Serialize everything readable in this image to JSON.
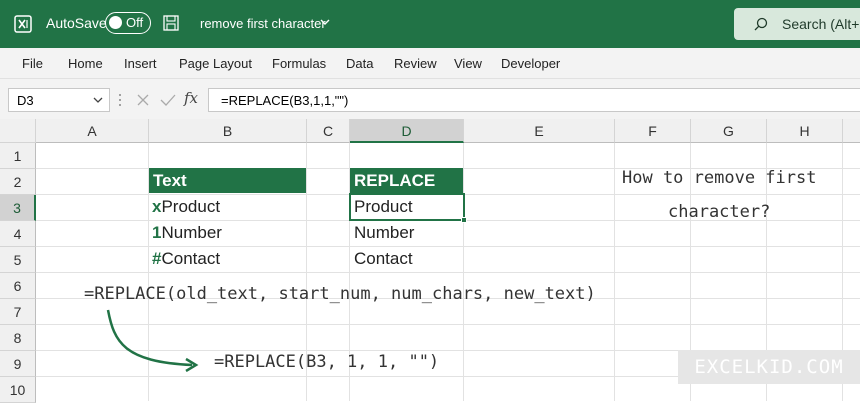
{
  "titlebar": {
    "autosave_label": "AutoSave",
    "toggle_label": "Off",
    "doc_title": "remove first character",
    "search_label": "Search (Alt+Q)"
  },
  "ribbon": {
    "tabs": [
      "File",
      "Home",
      "Insert",
      "Page Layout",
      "Formulas",
      "Data",
      "Review",
      "View",
      "Developer"
    ]
  },
  "formula_bar": {
    "name_box": "D3",
    "fx": "fx",
    "formula": "=REPLACE(B3,1,1,\"\")"
  },
  "grid": {
    "columns": [
      "A",
      "B",
      "C",
      "D",
      "E",
      "F",
      "G",
      "H"
    ],
    "rows": [
      "1",
      "2",
      "3",
      "4",
      "5",
      "6",
      "7",
      "8",
      "9",
      "10"
    ],
    "selected_column": "D",
    "selected_row": "3"
  },
  "cells": {
    "b2": "Text",
    "d2": "REPLACE",
    "b3_prefix": "x",
    "b3_rest": "Product",
    "b4_prefix": "1",
    "b4_rest": "Number",
    "b5_prefix": "#",
    "b5_rest": "Contact",
    "d3": "Product",
    "d4": "Number",
    "d5": "Contact"
  },
  "annotations": {
    "question_line1": "How to remove first",
    "question_line2": "character?",
    "syntax": "=REPLACE(old_text, start_num, num_chars, new_text)",
    "example": "=REPLACE(B3, 1, 1, \"\")"
  },
  "watermark": "EXCELKID.COM",
  "colors": {
    "accent": "#217346",
    "header_fill": "#217346"
  }
}
